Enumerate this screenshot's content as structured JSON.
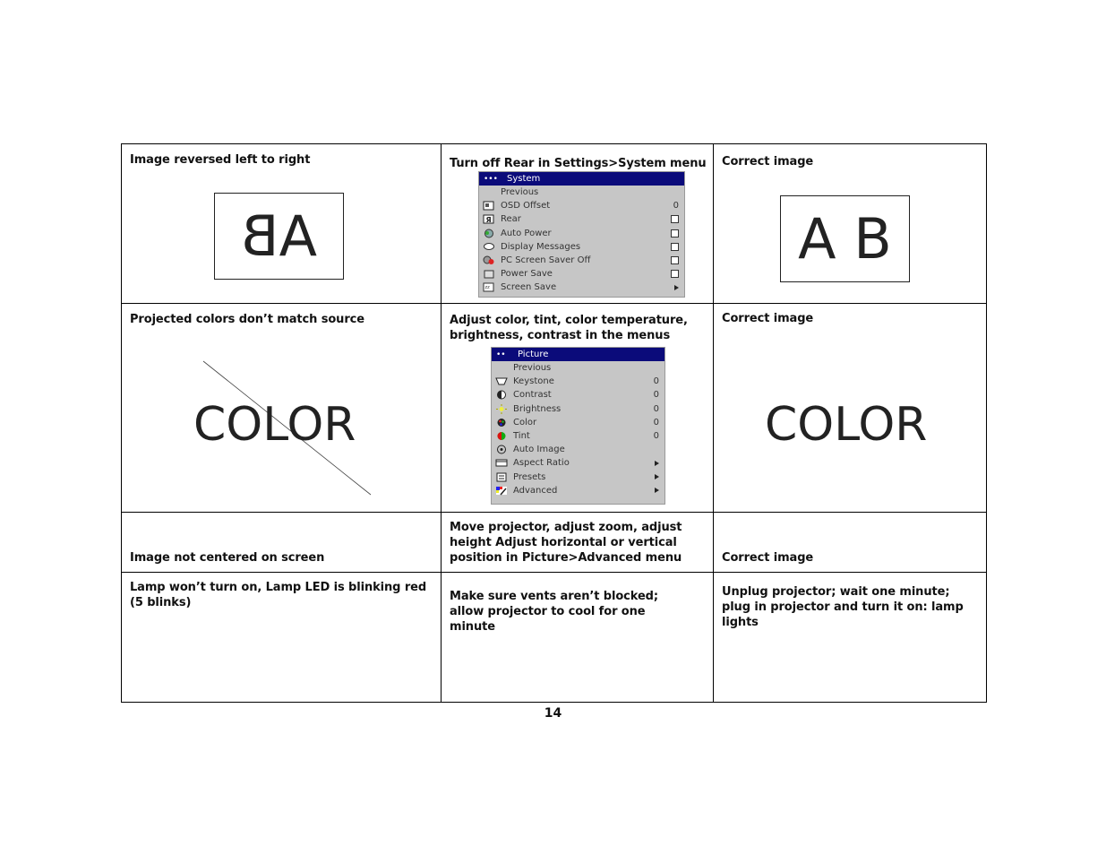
{
  "page_number": "14",
  "rows": [
    {
      "problem": "Image reversed left to right",
      "solution": "Turn off Rear in Settings>System menu",
      "result": "Correct image",
      "problem_image_text": "AB",
      "result_image_text": "A B"
    },
    {
      "problem": "Projected colors don’t match source",
      "solution": "Adjust color, tint, color temperature, brightness, contrast in the menus",
      "result": "Correct image",
      "problem_image_text": "COLOR",
      "result_image_text": "COLOR"
    },
    {
      "problem": "Image not centered on screen",
      "solution": "Move projector, adjust zoom, adjust height Adjust horizontal or vertical position in Picture>Advanced menu",
      "result": "Correct image"
    },
    {
      "problem": "Lamp won’t turn on, Lamp LED is blinking red (5 blinks)",
      "solution": "Make sure vents aren’t blocked; allow projector to cool for one minute",
      "result": "Unplug projector; wait one minute; plug in projector and turn it on: lamp lights"
    }
  ],
  "system_menu": {
    "header_dots": "•••",
    "title": "System",
    "items": [
      {
        "label": "Previous",
        "icon": "none",
        "control": "none"
      },
      {
        "label": "OSD Offset",
        "icon": "osd-offset-icon",
        "control": "value",
        "value": "0"
      },
      {
        "label": "Rear",
        "icon": "rear-icon",
        "control": "checkbox",
        "checked": false
      },
      {
        "label": "Auto Power",
        "icon": "auto-power-icon",
        "control": "checkbox",
        "checked": false
      },
      {
        "label": "Display Messages",
        "icon": "display-messages-icon",
        "control": "checkbox",
        "checked": false
      },
      {
        "label": "PC Screen Saver Off",
        "icon": "pc-screen-saver-icon",
        "control": "checkbox",
        "checked": false
      },
      {
        "label": "Power Save",
        "icon": "power-save-icon",
        "control": "checkbox",
        "checked": false
      },
      {
        "label": "Screen Save",
        "icon": "screen-save-icon",
        "control": "submenu"
      }
    ]
  },
  "picture_menu": {
    "header_dots": "••",
    "title": "Picture",
    "items": [
      {
        "label": "Previous",
        "icon": "none",
        "control": "none"
      },
      {
        "label": "Keystone",
        "icon": "keystone-icon",
        "control": "value",
        "value": "0"
      },
      {
        "label": "Contrast",
        "icon": "contrast-icon",
        "control": "value",
        "value": "0"
      },
      {
        "label": "Brightness",
        "icon": "brightness-icon",
        "control": "value",
        "value": "0"
      },
      {
        "label": "Color",
        "icon": "color-icon",
        "control": "value",
        "value": "0"
      },
      {
        "label": "Tint",
        "icon": "tint-icon",
        "control": "value",
        "value": "0"
      },
      {
        "label": "Auto Image",
        "icon": "auto-image-icon",
        "control": "none"
      },
      {
        "label": "Aspect Ratio",
        "icon": "aspect-ratio-icon",
        "control": "submenu"
      },
      {
        "label": "Presets",
        "icon": "presets-icon",
        "control": "submenu"
      },
      {
        "label": "Advanced",
        "icon": "advanced-icon",
        "control": "submenu"
      }
    ]
  },
  "colors": {
    "menu_header_bg": "#0b0b7a",
    "menu_bg": "#c6c6c6"
  }
}
